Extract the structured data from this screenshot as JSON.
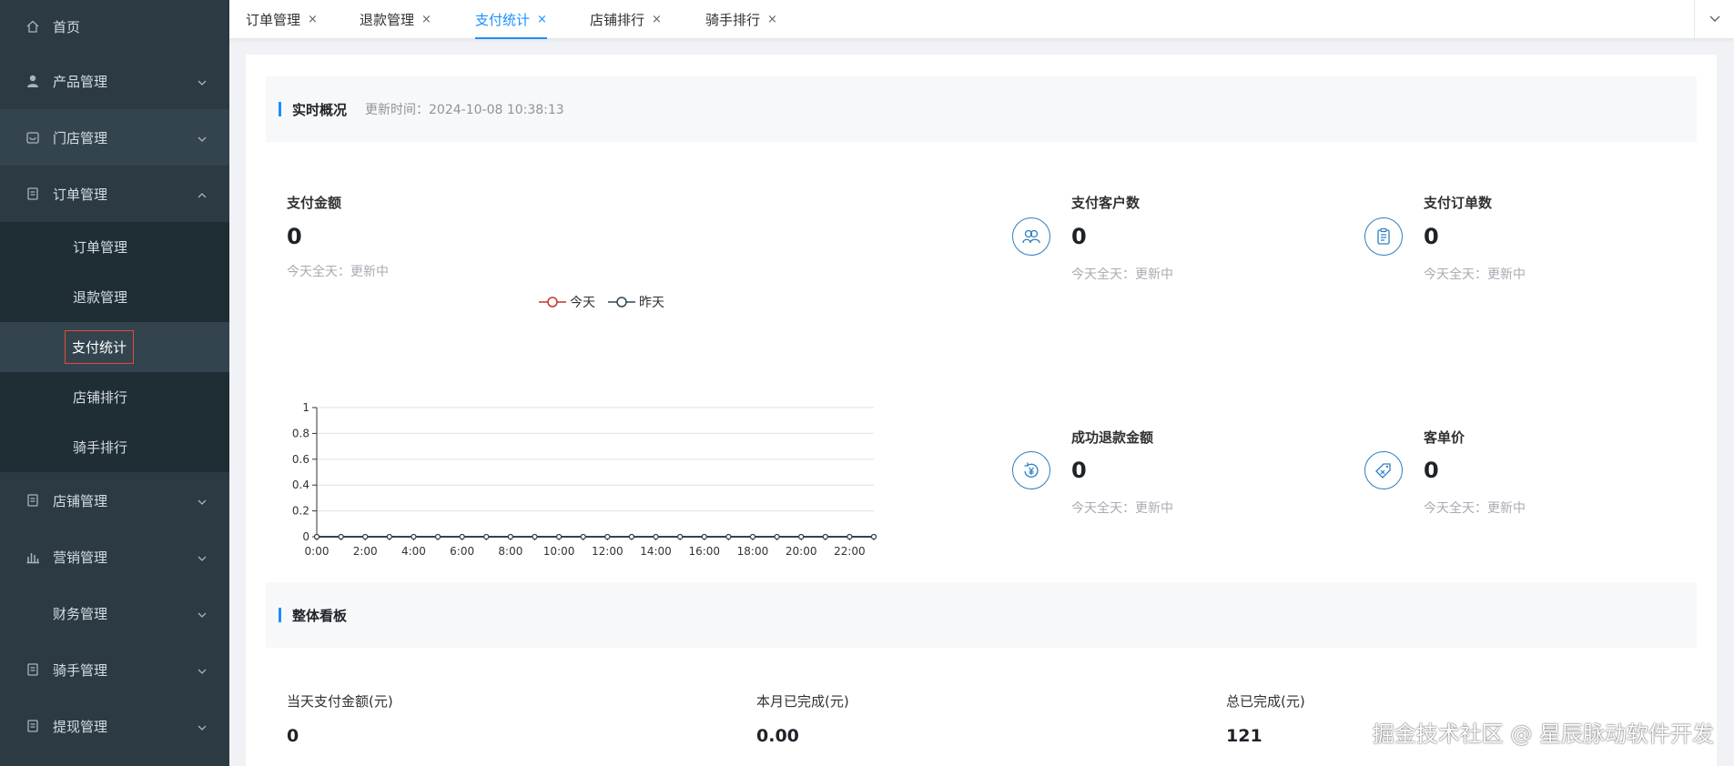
{
  "sidebar": {
    "items": [
      {
        "label": "首页",
        "icon": "home-icon",
        "has_arrow": false
      },
      {
        "label": "产品管理",
        "icon": "user-icon",
        "has_arrow": true
      },
      {
        "label": "门店管理",
        "icon": "store-icon",
        "has_arrow": true
      },
      {
        "label": "订单管理",
        "icon": "order-icon",
        "has_arrow": true,
        "expanded": true
      },
      {
        "label": "店铺管理",
        "icon": "shop-icon",
        "has_arrow": true
      },
      {
        "label": "营销管理",
        "icon": "chart-bar-icon",
        "has_arrow": true
      },
      {
        "label": "财务管理",
        "icon": "",
        "has_arrow": true
      },
      {
        "label": "骑手管理",
        "icon": "rider-icon",
        "has_arrow": true
      },
      {
        "label": "提现管理",
        "icon": "withdraw-icon",
        "has_arrow": true
      }
    ],
    "order_sub": [
      "订单管理",
      "退款管理",
      "支付统计",
      "店铺排行",
      "骑手排行"
    ],
    "selected_sub": "支付统计"
  },
  "tabs": [
    {
      "label": "订单管理",
      "active": false
    },
    {
      "label": "退款管理",
      "active": false
    },
    {
      "label": "支付统计",
      "active": true
    },
    {
      "label": "店铺排行",
      "active": false
    },
    {
      "label": "骑手排行",
      "active": false
    }
  ],
  "tab_close_glyph": "×",
  "realtime": {
    "title": "实时概况",
    "update_prefix": "更新时间：",
    "update_time": "2024-10-08 10:38:13"
  },
  "stats": {
    "pay_amount": {
      "label": "支付金额",
      "value": "0",
      "sub": "今天全天：更新中"
    },
    "pay_customers": {
      "label": "支付客户数",
      "value": "0",
      "sub": "今天全天：更新中"
    },
    "pay_orders": {
      "label": "支付订单数",
      "value": "0",
      "sub": "今天全天：更新中"
    },
    "refund_amount": {
      "label": "成功退款金额",
      "value": "0",
      "sub": "今天全天：更新中"
    },
    "unit_price": {
      "label": "客单价",
      "value": "0",
      "sub": "今天全天：更新中"
    }
  },
  "chart_data": {
    "type": "line",
    "x": [
      "0:00",
      "1:00",
      "2:00",
      "3:00",
      "4:00",
      "5:00",
      "6:00",
      "7:00",
      "8:00",
      "9:00",
      "10:00",
      "11:00",
      "12:00",
      "13:00",
      "14:00",
      "15:00",
      "16:00",
      "17:00",
      "18:00",
      "19:00",
      "20:00",
      "21:00",
      "22:00",
      "23:00"
    ],
    "x_tick_labels": [
      "0:00",
      "2:00",
      "4:00",
      "6:00",
      "8:00",
      "10:00",
      "12:00",
      "14:00",
      "16:00",
      "18:00",
      "20:00",
      "22:00"
    ],
    "series": [
      {
        "name": "今天",
        "color": "#c23531",
        "values": [
          0,
          0,
          0,
          0,
          0,
          0,
          0,
          0,
          0,
          0,
          0,
          0,
          0,
          0,
          0,
          0,
          0,
          0,
          0,
          0,
          0,
          0,
          0,
          0
        ]
      },
      {
        "name": "昨天",
        "color": "#2f4554",
        "values": [
          0,
          0,
          0,
          0,
          0,
          0,
          0,
          0,
          0,
          0,
          0,
          0,
          0,
          0,
          0,
          0,
          0,
          0,
          0,
          0,
          0,
          0,
          0,
          0
        ]
      }
    ],
    "ylim": [
      0,
      1
    ],
    "y_ticks": [
      "0",
      "0.2",
      "0.4",
      "0.6",
      "0.8",
      "1"
    ],
    "grid": true,
    "legend": "top-center"
  },
  "board": {
    "title": "整体看板",
    "items": [
      {
        "label": "当天支付金额(元)",
        "value": "0"
      },
      {
        "label": "本月已完成(元)",
        "value": "0.00"
      },
      {
        "label": "总已完成(元)",
        "value": "121"
      }
    ]
  },
  "watermark": "掘金技术社区 @ 星辰脉动软件开发",
  "colors": {
    "accent": "#1890ff",
    "sidebar_bg": "#2b3a43",
    "icon_blue": "#2d7fc1"
  }
}
